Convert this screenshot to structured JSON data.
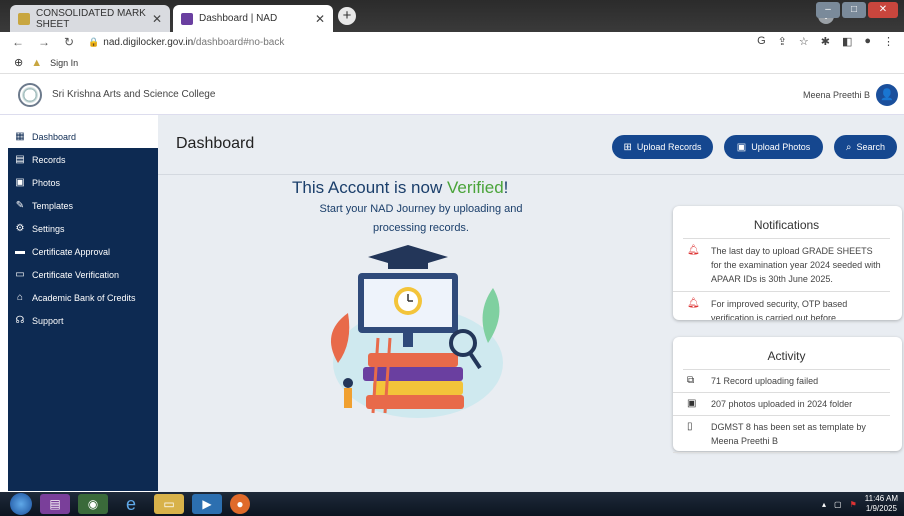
{
  "browser": {
    "tabs": [
      {
        "title": "CONSOLIDATED MARK SHEET",
        "active": false
      },
      {
        "title": "Dashboard | NAD",
        "active": true
      }
    ],
    "url_host": "nad.digilocker.gov.in",
    "url_path": "/dashboard#no-back",
    "bookmark_label": "Sign In"
  },
  "header": {
    "college_name": "Sri Krishna Arts and Science College",
    "user_name": "Meena Preethi B"
  },
  "sidebar": {
    "items": [
      {
        "label": "Dashboard",
        "icon": "dashboard-icon",
        "active": true
      },
      {
        "label": "Records",
        "icon": "records-icon"
      },
      {
        "label": "Photos",
        "icon": "photos-icon"
      },
      {
        "label": "Templates",
        "icon": "templates-icon"
      },
      {
        "label": "Settings",
        "icon": "gear-icon"
      },
      {
        "label": "Certificate Approval",
        "icon": "approval-icon"
      },
      {
        "label": "Certificate Verification",
        "icon": "verification-icon"
      },
      {
        "label": "Academic Bank of Credits",
        "icon": "bank-icon"
      },
      {
        "label": "Support",
        "icon": "headset-icon"
      }
    ]
  },
  "main": {
    "title": "Dashboard",
    "buttons": {
      "upload_records": "Upload Records",
      "upload_photos": "Upload Photos",
      "search": "Search"
    },
    "verified_prefix": "This Account is now ",
    "verified_word": "Verified",
    "verified_suffix": "!",
    "journey_text": "Start your NAD Journey by uploading and processing records."
  },
  "notifications": {
    "title": "Notifications",
    "items": [
      "The last day to upload GRADE SHEETS for the examination year 2024 seeded with APAAR IDs is 30th June 2025.",
      "For improved security, OTP based verification is carried out before"
    ]
  },
  "activity": {
    "title": "Activity",
    "items": [
      "71 Record uploading failed",
      "207 photos uploaded in 2024 folder",
      "DGMST 8 has been set as template by Meena Preethi B"
    ]
  },
  "taskbar": {
    "time": "11:46 AM",
    "date": "1/9/2025"
  },
  "colors": {
    "sidebar_bg": "#0d2a52",
    "primary_button": "#15478f",
    "verified_green": "#4aa43a",
    "bell_red": "#d33333"
  }
}
